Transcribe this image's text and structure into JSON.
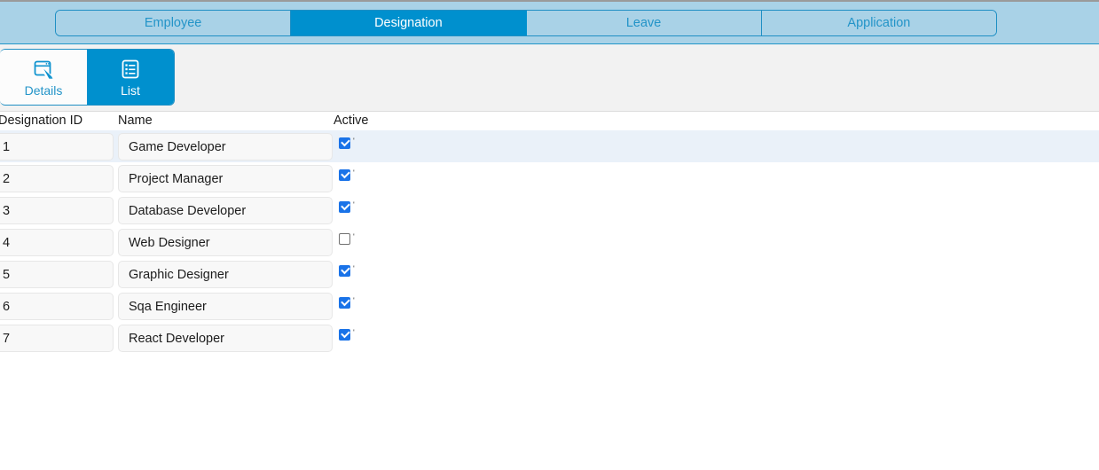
{
  "main_tabs": [
    {
      "label": "Employee",
      "active": false,
      "name": "tab-employee"
    },
    {
      "label": "Designation",
      "active": true,
      "name": "tab-designation"
    },
    {
      "label": "Leave",
      "active": false,
      "name": "tab-leave"
    },
    {
      "label": "Application",
      "active": false,
      "name": "tab-application"
    }
  ],
  "view_toolbar": {
    "buttons": [
      {
        "label": "Details",
        "icon": "window-edit-icon",
        "active": false
      },
      {
        "label": "List",
        "icon": "list-icon",
        "active": true
      }
    ]
  },
  "table": {
    "columns": [
      "Designation ID",
      "Name",
      "Active"
    ],
    "rows": [
      {
        "id": "1",
        "name": "Game Developer",
        "active": true,
        "marker": "'"
      },
      {
        "id": "2",
        "name": "Project Manager",
        "active": true,
        "marker": "'"
      },
      {
        "id": "3",
        "name": "Database Developer",
        "active": true,
        "marker": "'"
      },
      {
        "id": "4",
        "name": "Web Designer",
        "active": false,
        "marker": "'"
      },
      {
        "id": "5",
        "name": "Graphic Designer",
        "active": true,
        "marker": "'"
      },
      {
        "id": "6",
        "name": "Sqa Engineer",
        "active": true,
        "marker": "'"
      },
      {
        "id": "7",
        "name": "React Developer",
        "active": true,
        "marker": "'"
      }
    ],
    "selected_row_index": 0
  },
  "colors": {
    "tabstrip_bg": "#a9d2e7",
    "accent": "#0090ce",
    "accent_border": "#1f8fc4",
    "link_text": "#2394c8",
    "toolbar_bg": "#f2f2f2",
    "row_selected_bg": "#eaf1f9",
    "cell_bg": "#f8f8f8",
    "checkbox_on": "#1a73e8"
  }
}
